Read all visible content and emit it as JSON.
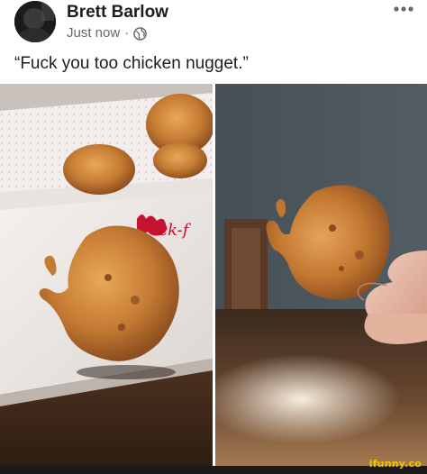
{
  "post": {
    "author_name": "Brett Barlow",
    "timestamp": "Just now",
    "separator": "·",
    "privacy_icon": "globe-icon",
    "more_icon": "more-options-icon",
    "caption": "“Fuck you too chicken nugget.”"
  },
  "photos": {
    "left_box_print": "ck-f",
    "watermark": "ifunny.co"
  },
  "colors": {
    "name_text": "#1c1e21",
    "secondary_text": "#65676b",
    "watermark": "#f2c400"
  }
}
